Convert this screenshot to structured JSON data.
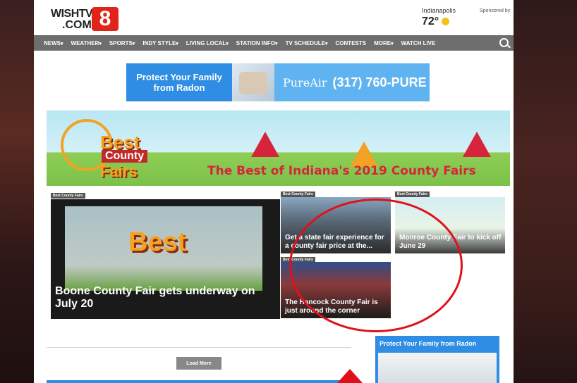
{
  "header": {
    "logo_line1": "WISHTV",
    "logo_line2": ".COM",
    "logo_mark": "8",
    "weather_city": "Indianapolis",
    "weather_temp": "72°",
    "weather_icon": "sun-icon",
    "sponsored": "Sponsored by"
  },
  "nav": {
    "items": [
      {
        "label": "NEWS",
        "caret": true
      },
      {
        "label": "WEATHER",
        "caret": true
      },
      {
        "label": "SPORTS",
        "caret": true
      },
      {
        "label": "INDY STYLE",
        "caret": true
      },
      {
        "label": "LIVING LOCAL",
        "caret": true
      },
      {
        "label": "STATION INFO",
        "caret": true
      },
      {
        "label": "TV SCHEDULE",
        "caret": true
      },
      {
        "label": "CONTESTS",
        "caret": false
      },
      {
        "label": "MORE",
        "caret": true
      },
      {
        "label": "WATCH LIVE",
        "caret": false
      }
    ],
    "search_icon": "search-icon"
  },
  "ad_top": {
    "text": "Protect Your Family from Radon",
    "brand": "PureAir",
    "phone": "(317) 760-PURE"
  },
  "banner": {
    "best": "Best",
    "county": "County",
    "fairs": "Fairs",
    "headline": "The Best of Indiana's 2019 County Fairs"
  },
  "stories": [
    {
      "tag": "Best County Fairs",
      "title": "Boone County Fair gets underway on July 20"
    },
    {
      "tag": "Best County Fairs",
      "title": "Get a state fair experience for a county fair price at the..."
    },
    {
      "tag": "Best County Fairs",
      "title": "Monroe County Fair to kick off June 29"
    },
    {
      "tag": "Best County Fairs",
      "title": "The Hancock County Fair is just around the corner"
    }
  ],
  "load_more": "Load More",
  "side_ad": {
    "title": "Protect Your Family from Radon"
  },
  "colors": {
    "nav_bg": "#6e6e6e",
    "brand_red": "#e2231a",
    "ad_blue": "#2f8de3",
    "annotation_red": "#e0101a"
  }
}
